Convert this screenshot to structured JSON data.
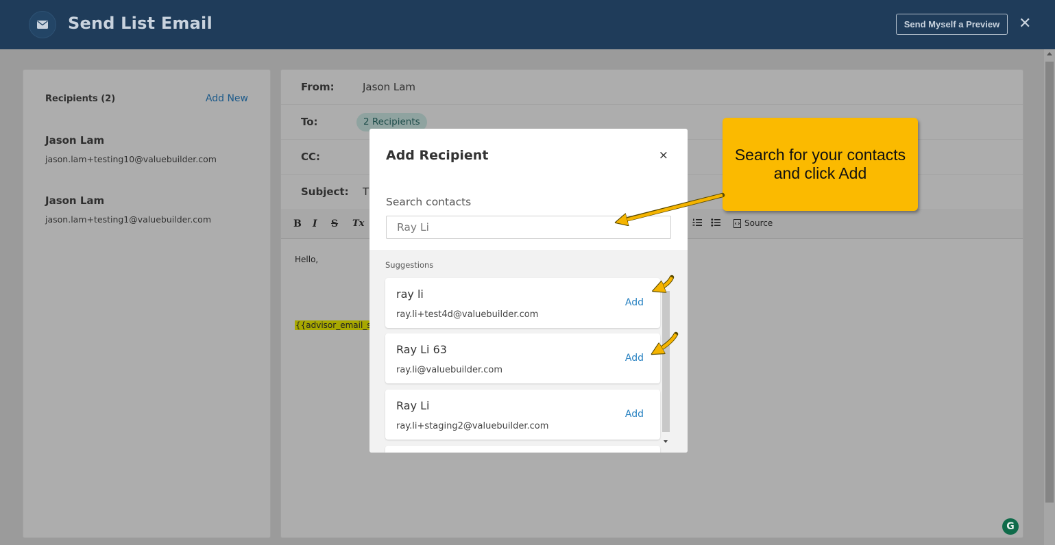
{
  "header": {
    "title": "Send List Email",
    "preview_button": "Send Myself a Preview",
    "close_glyph": "✕",
    "icon": "mail-icon"
  },
  "recipients_panel": {
    "heading": "Recipients (2)",
    "add_new": "Add New",
    "items": [
      {
        "name": "Jason Lam",
        "email": "jason.lam+testing10@valuebuilder.com"
      },
      {
        "name": "Jason Lam",
        "email": "jason.lam+testing1@valuebuilder.com"
      }
    ]
  },
  "compose": {
    "from_label": "From:",
    "from_value": "Jason Lam",
    "to_label": "To:",
    "to_chip": "2 Recipients",
    "cc_label": "CC:",
    "subject_label": "Subject:",
    "subject_value": "T",
    "toolbar": {
      "bold": "B",
      "italic": "I",
      "strike": "S",
      "clear_format": "Tx",
      "source": "Source"
    },
    "body_greeting": "Hello,",
    "signature_token": "{{advisor_email_sig"
  },
  "modal": {
    "title": "Add Recipient",
    "close_glyph": "×",
    "search_label": "Search contacts",
    "search_value": "Ray Li",
    "suggestions_label": "Suggestions",
    "suggestions": [
      {
        "name": "ray li",
        "email": "ray.li+test4d@valuebuilder.com",
        "action": "Add"
      },
      {
        "name": "Ray Li 63",
        "email": "ray.li@valuebuilder.com",
        "action": "Add"
      },
      {
        "name": "Ray Li",
        "email": "ray.li+staging2@valuebuilder.com",
        "action": "Add"
      }
    ]
  },
  "callout": {
    "text": "Search for your contacts and click Add",
    "color": "#fbba00"
  },
  "grammarly_glyph": "G",
  "colors": {
    "header_bg": "#1f3c5a",
    "overlay_bg": "#9b9b9b",
    "link": "#2b83c2",
    "arrow": "#f5b400"
  }
}
